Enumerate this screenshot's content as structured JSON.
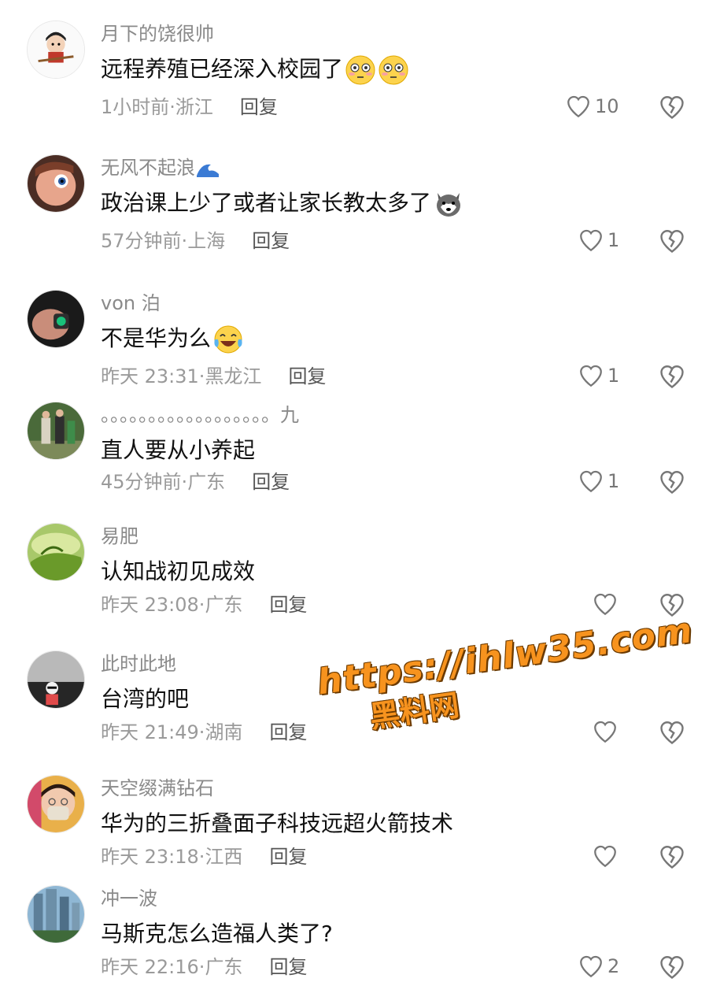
{
  "comments": [
    {
      "username": "月下的饶很帅",
      "text": "远程养殖已经深入校园了",
      "emojis": [
        "flushed-face",
        "flushed-face"
      ],
      "time": "1小时前",
      "location": "浙江",
      "reply": "回复",
      "likes": "10"
    },
    {
      "username": "无风不起浪",
      "username_emoji": "wave",
      "text": "政治课上少了或者让家长教太多了",
      "emojis": [
        "husky-dog"
      ],
      "time": "57分钟前",
      "location": "上海",
      "reply": "回复",
      "likes": "1"
    },
    {
      "username": "von 泊",
      "text": "不是华为么",
      "emojis": [
        "laughing-tears"
      ],
      "time": "昨天 23:31",
      "location": "黑龙江",
      "reply": "回复",
      "likes": "1"
    },
    {
      "username": "。。。。。。。。。。。。。。。。。。九",
      "text": "直人要从小养起",
      "emojis": [],
      "time": "45分钟前",
      "location": "广东",
      "reply": "回复",
      "likes": "1"
    },
    {
      "username": "易肥",
      "text": "认知战初见成效",
      "emojis": [],
      "time": "昨天 23:08",
      "location": "广东",
      "reply": "回复",
      "likes": ""
    },
    {
      "username": "此时此地",
      "text": "台湾的吧",
      "emojis": [],
      "time": "昨天 21:49",
      "location": "湖南",
      "reply": "回复",
      "likes": ""
    },
    {
      "username": "天空缀满钻石",
      "text": "华为的三折叠面子科技远超火箭技术",
      "emojis": [],
      "time": "昨天 23:18",
      "location": "江西",
      "reply": "回复",
      "likes": ""
    },
    {
      "username": "冲一波",
      "text": "马斯克怎么造福人类了?",
      "emojis": [],
      "time": "昨天 22:16",
      "location": "广东",
      "reply": "回复",
      "likes": "2"
    }
  ],
  "watermark": {
    "url": "https://ihlw35.com",
    "name": "黑料网"
  },
  "colors": {
    "username": "#8a8a8a",
    "text": "#111111",
    "meta": "#9a9a9a",
    "icon": "#777777",
    "watermark": "#f7931e"
  }
}
